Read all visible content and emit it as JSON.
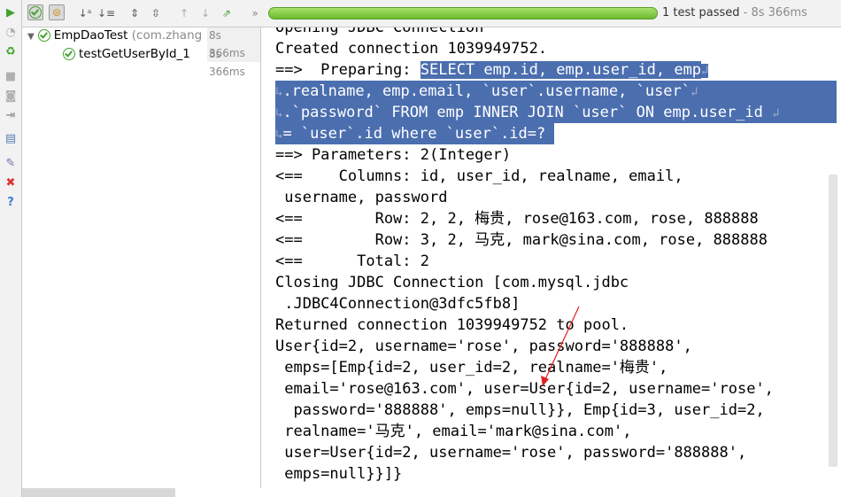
{
  "toolbar": {
    "progress": 1.0,
    "status_text": "1 test passed",
    "status_sep": " - ",
    "status_time": "8s 366ms",
    "colors": {
      "progress": "#6dbb2e",
      "selection": "#4b6eaf"
    }
  },
  "tree": {
    "suite": {
      "name": "EmpDaoTest",
      "package": "(com.zhang",
      "time": "8s 366ms"
    },
    "test": {
      "name": "testGetUserById_1",
      "time": "8s 366ms"
    }
  },
  "console": {
    "lines": [
      "Opening JDBC Connection",
      "Created connection 1039949752.",
      "==>  Preparing: ",
      "SELECT emp.id, emp.user_id, emp",
      ".realname, emp.email, `user`.username, `user`",
      ".`password` FROM emp INNER JOIN `user` ON emp.user_id ",
      "= `user`.id where `user`.id=? ",
      "==> Parameters: 2(Integer)",
      "<==    Columns: id, user_id, realname, email,",
      " username, password",
      "<==        Row: 2, 2, 梅贵, rose@163.com, rose, 888888",
      "<==        Row: 3, 2, 马克, mark@sina.com, rose, 888888",
      "<==      Total: 2",
      "Closing JDBC Connection [com.mysql.jdbc",
      " .JDBC4Connection@3dfc5fb8]",
      "Returned connection 1039949752 to pool.",
      "User{id=2, username='rose', password='888888',",
      " emps=[Emp{id=2, user_id=2, realname='梅贵',",
      " email='rose@163.com', user=User{id=2, username='rose',",
      "  password='888888', emps=null}}, Emp{id=3, user_id=2,",
      " realname='马克', email='mark@sina.com',",
      " user=User{id=2, username='rose', password='888888',",
      " emps=null}}]}"
    ]
  }
}
